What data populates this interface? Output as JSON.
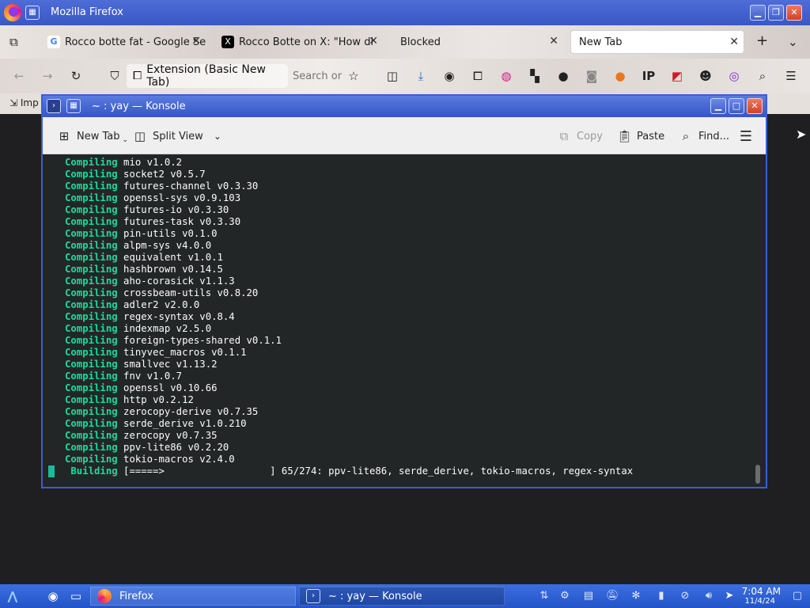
{
  "firefox": {
    "window_title": "Mozilla Firefox",
    "tabs": [
      {
        "label": "Rocco botte fat - Google Se",
        "favicon": "G"
      },
      {
        "label": "Rocco Botte on X: \"How di",
        "favicon": "X"
      },
      {
        "label": "Blocked",
        "favicon": ""
      },
      {
        "label": "New Tab",
        "favicon": ""
      }
    ],
    "urlbar_extension_label": "Extension (Basic New Tab)",
    "search_placeholder": "Search or",
    "bookmark_label": "Imp"
  },
  "konsole": {
    "title": "~ : yay — Konsole",
    "toolbar": {
      "new_tab": "New Tab",
      "split_view": "Split View",
      "copy": "Copy",
      "paste": "Paste",
      "find": "Find..."
    },
    "lines": [
      {
        "kw": "Compiling",
        "text": "mio v1.0.2"
      },
      {
        "kw": "Compiling",
        "text": "socket2 v0.5.7"
      },
      {
        "kw": "Compiling",
        "text": "futures-channel v0.3.30"
      },
      {
        "kw": "Compiling",
        "text": "openssl-sys v0.9.103"
      },
      {
        "kw": "Compiling",
        "text": "futures-io v0.3.30"
      },
      {
        "kw": "Compiling",
        "text": "futures-task v0.3.30"
      },
      {
        "kw": "Compiling",
        "text": "pin-utils v0.1.0"
      },
      {
        "kw": "Compiling",
        "text": "alpm-sys v4.0.0"
      },
      {
        "kw": "Compiling",
        "text": "equivalent v1.0.1"
      },
      {
        "kw": "Compiling",
        "text": "hashbrown v0.14.5"
      },
      {
        "kw": "Compiling",
        "text": "aho-corasick v1.1.3"
      },
      {
        "kw": "Compiling",
        "text": "crossbeam-utils v0.8.20"
      },
      {
        "kw": "Compiling",
        "text": "adler2 v2.0.0"
      },
      {
        "kw": "Compiling",
        "text": "regex-syntax v0.8.4"
      },
      {
        "kw": "Compiling",
        "text": "indexmap v2.5.0"
      },
      {
        "kw": "Compiling",
        "text": "foreign-types-shared v0.1.1"
      },
      {
        "kw": "Compiling",
        "text": "tinyvec_macros v0.1.1"
      },
      {
        "kw": "Compiling",
        "text": "smallvec v1.13.2"
      },
      {
        "kw": "Compiling",
        "text": "fnv v1.0.7"
      },
      {
        "kw": "Compiling",
        "text": "openssl v0.10.66"
      },
      {
        "kw": "Compiling",
        "text": "http v0.2.12"
      },
      {
        "kw": "Compiling",
        "text": "zerocopy-derive v0.7.35"
      },
      {
        "kw": "Compiling",
        "text": "serde_derive v1.0.210"
      },
      {
        "kw": "Compiling",
        "text": "zerocopy v0.7.35"
      },
      {
        "kw": "Compiling",
        "text": "ppv-lite86 v0.2.20"
      },
      {
        "kw": "Compiling",
        "text": "tokio-macros v2.4.0"
      },
      {
        "kw": " Building",
        "text": "[=====>                  ] 65/274: ppv-lite86, serde_derive, tokio-macros, regex-syntax"
      }
    ]
  },
  "taskbar": {
    "items": [
      {
        "label": "Firefox"
      },
      {
        "label": "~ : yay — Konsole"
      }
    ],
    "clock_time": "7:04 AM",
    "clock_date": "11/4/24"
  },
  "colors": {
    "accent_blue": "#3a5fd0",
    "terminal_bg": "#232627",
    "terminal_keyword": "#1cdc9a",
    "terminal_text": "#fcfcfc"
  }
}
